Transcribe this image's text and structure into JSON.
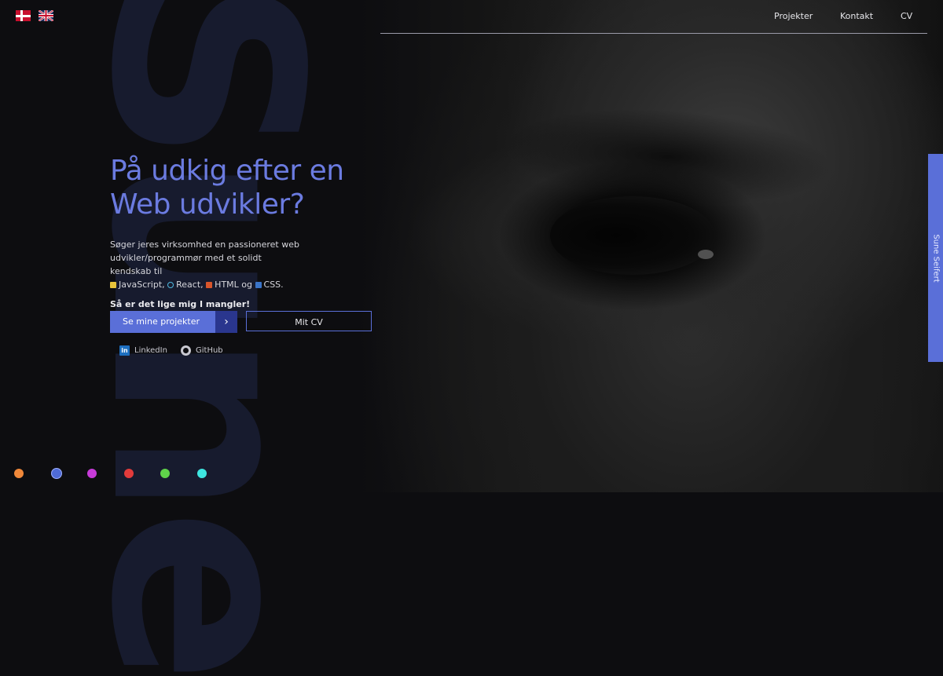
{
  "flags": [
    {
      "name": "danish-flag-icon"
    },
    {
      "name": "uk-flag-icon"
    }
  ],
  "watermark": "Sune",
  "nav": {
    "items": [
      "Projekter",
      "Kontakt",
      "CV"
    ]
  },
  "hero": {
    "title": "På udkig efter en Web udvikler?",
    "text_intro": "Søger jeres virksomhed en passioneret web udvikler/programmør med et solidt kendskab til",
    "tech": [
      "JavaScript",
      "React",
      "HTML",
      "CSS"
    ],
    "sep_1": ",",
    "sep_2": ",",
    "sep_3": "og",
    "sep_end": ".",
    "strong": "Så er det lige mig I mangler!"
  },
  "buttons": {
    "primary": "Se mine projekter",
    "primary_arrow": "›",
    "secondary": "Mit CV"
  },
  "social": {
    "linkedin": "LinkedIn",
    "linkedin_icon": "in",
    "github": "GitHub"
  },
  "side_tab": "Sune Seifert",
  "theme_dots": {
    "colors": [
      "#f0883a",
      "#4f6bd6",
      "#c73bd9",
      "#e23b3b",
      "#5fd34a",
      "#3ee6e0"
    ],
    "selected": 1
  }
}
